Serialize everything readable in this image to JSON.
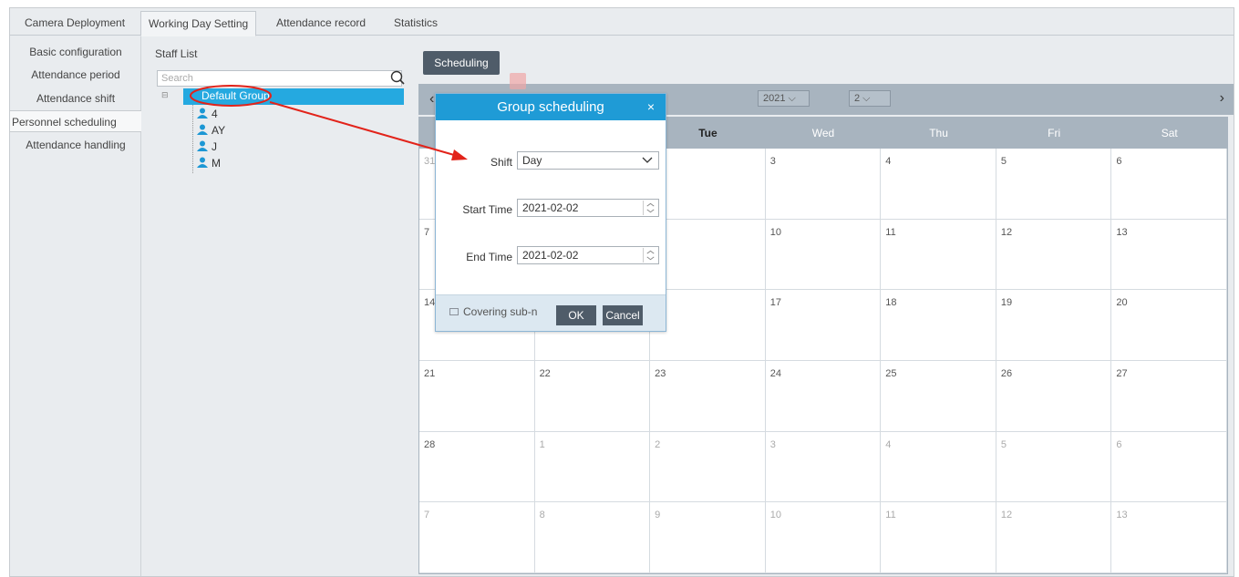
{
  "tabs": [
    {
      "label": "Camera Deployment"
    },
    {
      "label": "Working Day Setting"
    },
    {
      "label": "Attendance record"
    },
    {
      "label": "Statistics"
    }
  ],
  "active_tab": "Working Day Setting",
  "left_menu": [
    {
      "label": "Basic configuration"
    },
    {
      "label": "Attendance period"
    },
    {
      "label": "Attendance shift"
    },
    {
      "label": "Personnel scheduling"
    },
    {
      "label": "Attendance handling"
    }
  ],
  "staff_list": {
    "title": "Staff List",
    "search_placeholder": "Search",
    "group": "Default Group",
    "members": [
      "4",
      "AY",
      "J",
      "M"
    ]
  },
  "main": {
    "scheduling_label": "Scheduling",
    "year": "2021",
    "month": "2",
    "prev_icon": "chevron-left-icon",
    "next_icon": "chevron-right-icon"
  },
  "calendar": {
    "day_names": [
      "",
      "",
      "Tue",
      "Wed",
      "Thu",
      "Fri",
      "Sat"
    ],
    "weeks": [
      [
        "31",
        "",
        "",
        "3",
        "4",
        "5",
        "6"
      ],
      [
        "7",
        "",
        "",
        "10",
        "11",
        "12",
        "13"
      ],
      [
        "14",
        "",
        "",
        "17",
        "18",
        "19",
        "20"
      ],
      [
        "21",
        "22",
        "23",
        "24",
        "25",
        "26",
        "27"
      ],
      [
        "28",
        "1",
        "2",
        "3",
        "4",
        "5",
        "6"
      ],
      [
        "7",
        "8",
        "9",
        "10",
        "11",
        "12",
        "13"
      ]
    ]
  },
  "dialog": {
    "title": "Group scheduling",
    "close": "×",
    "shift_label": "Shift",
    "shift_value": "Day",
    "start_label": "Start Time",
    "start_value": "2021-02-02",
    "end_label": "End Time",
    "end_value": "2021-02-02",
    "cover_label": "Covering sub-n",
    "ok_label": "OK",
    "cancel_label": "Cancel"
  },
  "colors": {
    "dialog_title": "#1f9bd6",
    "selected_row": "#25a9e0",
    "annotation": "#e2231a",
    "button": "#4f5c69"
  }
}
